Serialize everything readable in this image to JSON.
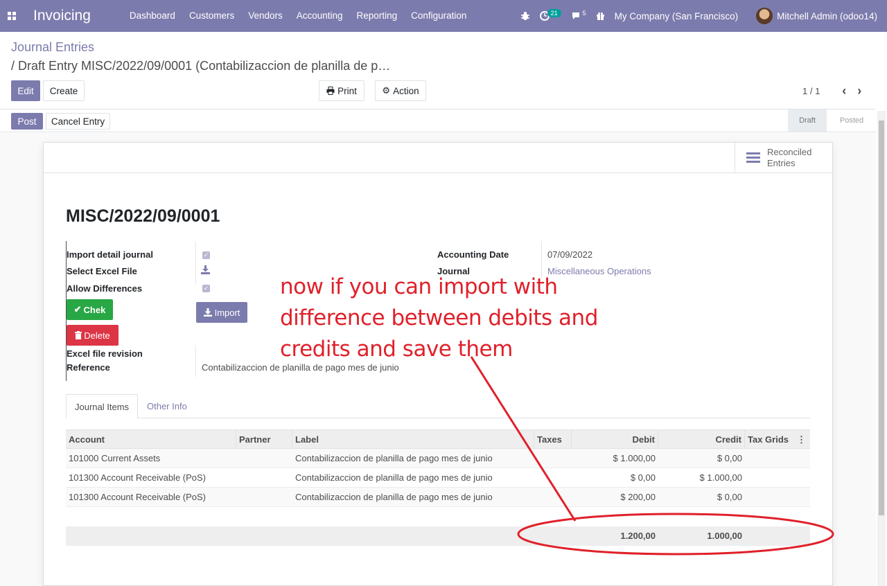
{
  "navbar": {
    "brand": "Invoicing",
    "menu": [
      "Dashboard",
      "Customers",
      "Vendors",
      "Accounting",
      "Reporting",
      "Configuration"
    ],
    "activity_badge": "21",
    "messages_badge": "5",
    "company": "My Company (San Francisco)",
    "user": "Mitchell Admin (odoo14)"
  },
  "breadcrumb": {
    "parent": "Journal Entries",
    "current": "/ Draft Entry MISC/2022/09/0001 (Contabilizaccion de planilla de p…"
  },
  "buttons": {
    "edit": "Edit",
    "create": "Create",
    "print": "Print",
    "action": "Action",
    "post": "Post",
    "cancel_entry": "Cancel Entry",
    "chek": "Chek",
    "delete": "Delete",
    "import": "Import"
  },
  "pager": {
    "value": "1 / 1"
  },
  "status": {
    "stages": [
      "Draft",
      "Posted"
    ],
    "current": "Draft"
  },
  "smart_button": {
    "line1": "Reconciled",
    "line2": "Entries"
  },
  "record": {
    "name": "MISC/2022/09/0001",
    "left_fields": {
      "import_detail_journal": "Import detail journal",
      "select_excel_file": "Select Excel File",
      "allow_differences": "Allow Differences",
      "excel_file_revision": "Excel file revision",
      "reference": "Reference"
    },
    "reference_value": "Contabilizaccion de planilla de pago mes de junio",
    "import_detail_journal_checked": true,
    "allow_differences_checked": true,
    "right_fields": {
      "accounting_date_label": "Accounting Date",
      "accounting_date": "07/09/2022",
      "journal_label": "Journal",
      "journal": "Miscellaneous Operations"
    }
  },
  "tabs": [
    "Journal Items",
    "Other Info"
  ],
  "table": {
    "headers": [
      "Account",
      "Partner",
      "Label",
      "Taxes",
      "Debit",
      "Credit",
      "Tax Grids"
    ],
    "rows": [
      {
        "account": "101000 Current Assets",
        "partner": "",
        "label": "Contabilizaccion de planilla de pago mes de junio",
        "taxes": "",
        "debit": "$ 1.000,00",
        "credit": "$ 0,00"
      },
      {
        "account": "101300 Account Receivable (PoS)",
        "partner": "",
        "label": "Contabilizaccion de planilla de pago mes de junio",
        "taxes": "",
        "debit": "$ 0,00",
        "credit": "$ 1.000,00"
      },
      {
        "account": "101300 Account Receivable (PoS)",
        "partner": "",
        "label": "Contabilizaccion de planilla de pago mes de junio",
        "taxes": "",
        "debit": "$ 200,00",
        "credit": "$ 0,00"
      }
    ],
    "totals": {
      "debit": "1.200,00",
      "credit": "1.000,00"
    }
  },
  "annotation": {
    "text": "now if you can import with difference between debits and credits and save them",
    "color": "#e0202a"
  },
  "colors": {
    "primary": "#7c7bad",
    "success": "#28a745",
    "danger": "#dc3545"
  }
}
